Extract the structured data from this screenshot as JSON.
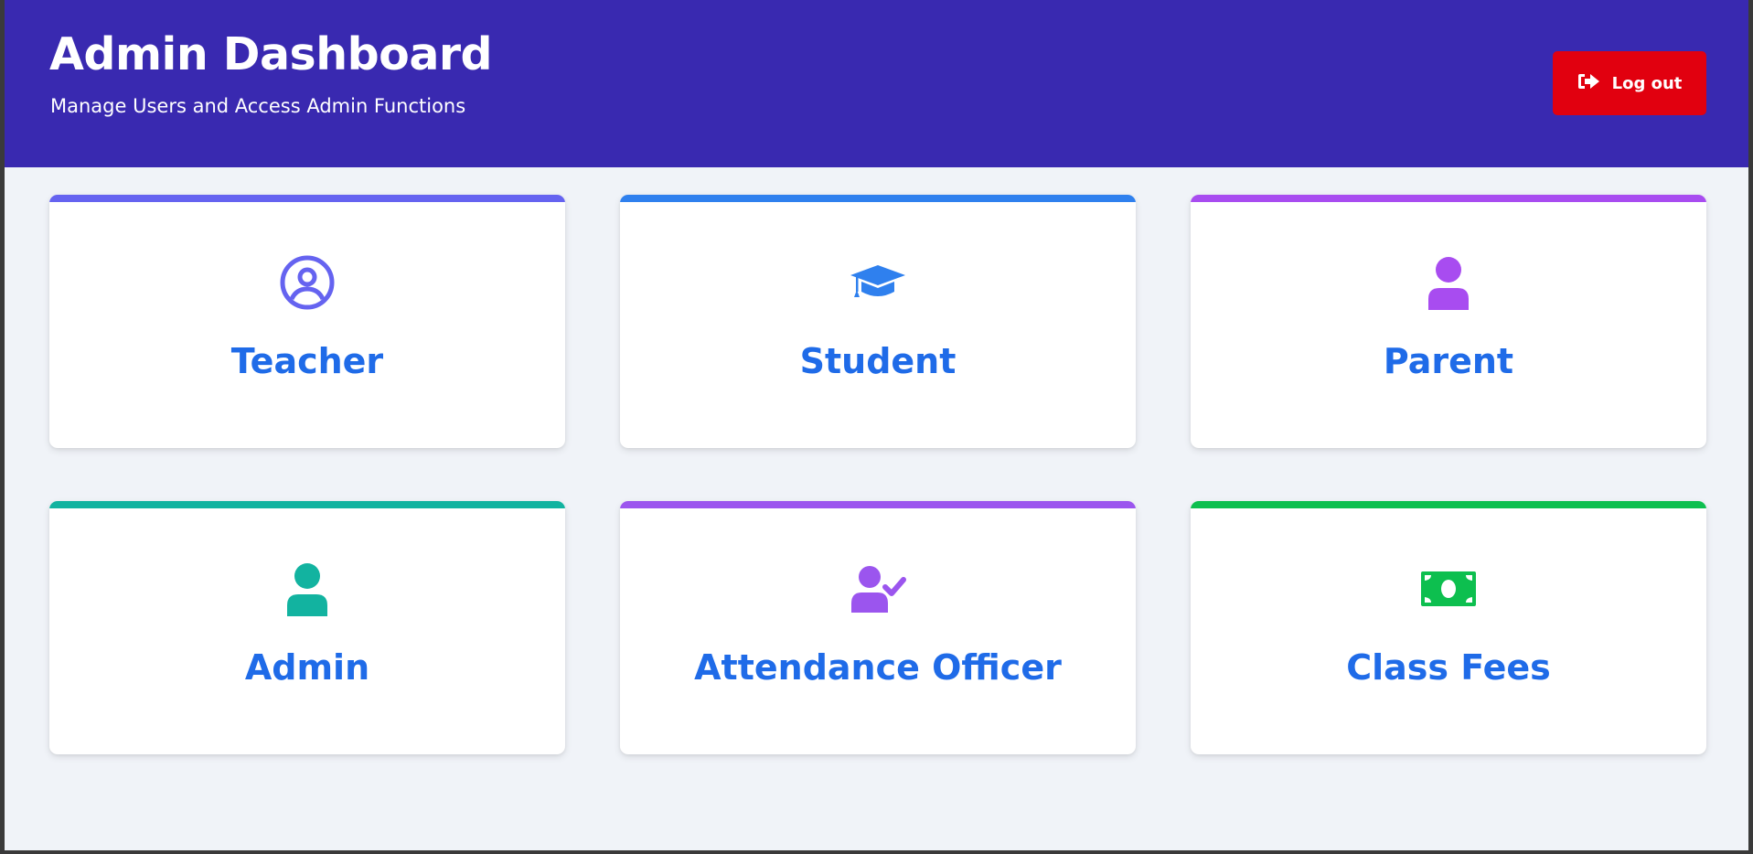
{
  "header": {
    "title": "Admin Dashboard",
    "subtitle": "Manage Users and Access Admin Functions",
    "logout_label": "Log out",
    "background": "#3929b0",
    "logout_color": "#e1000f"
  },
  "cards": [
    {
      "label": "Teacher",
      "icon": "user-circle-icon",
      "accent": "#6563f0"
    },
    {
      "label": "Student",
      "icon": "graduation-cap-icon",
      "accent": "#2f80ee"
    },
    {
      "label": "Parent",
      "icon": "user-icon",
      "accent": "#a84cf0"
    },
    {
      "label": "Admin",
      "icon": "user-icon",
      "accent": "#12b3a0"
    },
    {
      "label": "Attendance Officer",
      "icon": "user-check-icon",
      "accent": "#9b55ee"
    },
    {
      "label": "Class Fees",
      "icon": "money-bill-icon",
      "accent": "#0dbf4f"
    }
  ],
  "colors": {
    "page_background": "#f0f3f8",
    "card_label": "#1f6be8"
  }
}
